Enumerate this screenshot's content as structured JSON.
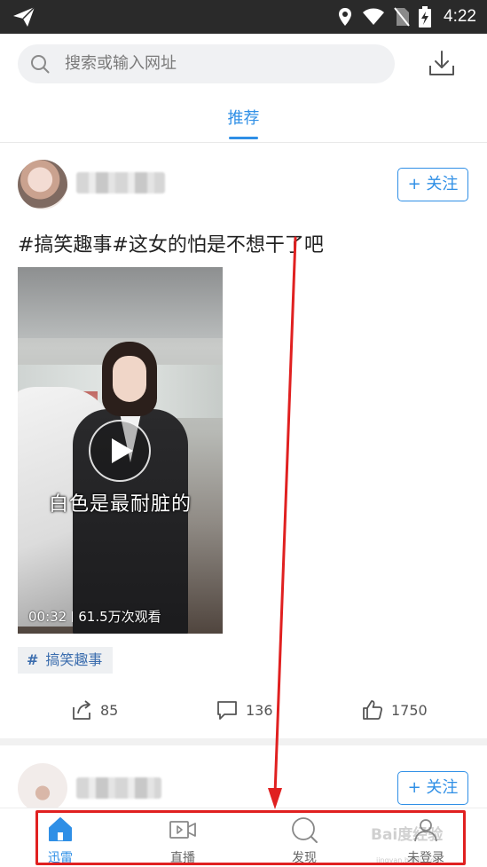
{
  "status_bar": {
    "time": "4:22",
    "icons": [
      "send-icon",
      "location-icon",
      "wifi-icon",
      "no-sim-icon",
      "battery-charging-icon"
    ]
  },
  "search": {
    "placeholder": "搜索或输入网址",
    "download_icon": "download-icon"
  },
  "tabs": [
    {
      "label": "推荐",
      "active": true
    }
  ],
  "feed": [
    {
      "follow_label": "+ 关注",
      "title": "#搞笑趣事#这女的怕是不想干了吧",
      "video": {
        "subtitle": "白色是最耐脏的",
        "duration": "00:32",
        "views": "61.5万次观看"
      },
      "topic_tag": "搞笑趣事",
      "topic_hash": "#",
      "actions": {
        "shares": "85",
        "comments": "136",
        "likes": "1750"
      }
    },
    {
      "follow_label": "+ 关注"
    }
  ],
  "bottom_nav": [
    {
      "label": "迅雷",
      "icon": "home-icon",
      "active": true
    },
    {
      "label": "直播",
      "icon": "live-video-icon",
      "active": false
    },
    {
      "label": "发现",
      "icon": "discover-icon",
      "active": false
    },
    {
      "label": "未登录",
      "icon": "user-icon",
      "active": false
    }
  ],
  "watermark": {
    "text": "Bai度经验",
    "sub": "jingyan.baidu.com"
  },
  "colors": {
    "accent": "#2f8fe6",
    "annotation": "#e02020",
    "status_bar": "#2a2a2a"
  }
}
